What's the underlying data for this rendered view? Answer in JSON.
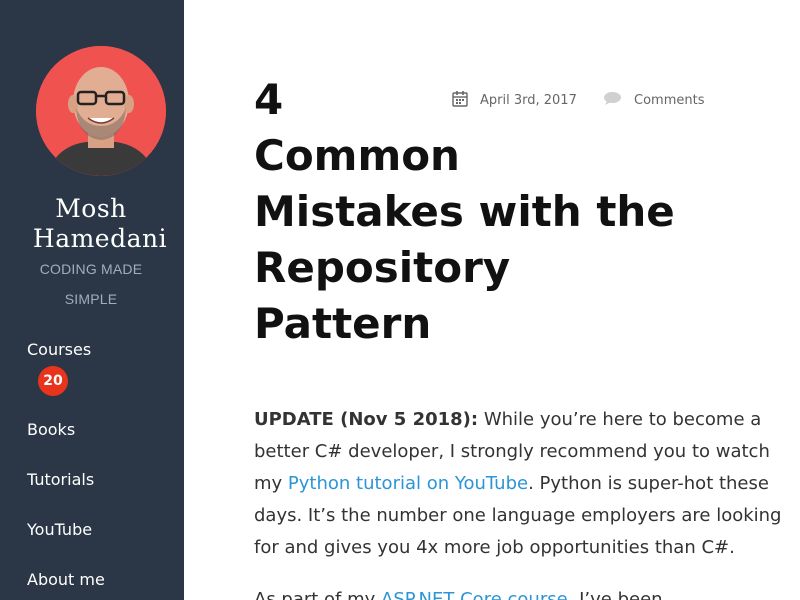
{
  "sidebar": {
    "author_first": "Mosh",
    "author_last": "Hamedani",
    "tagline_1": "CODING MADE",
    "tagline_2": "SIMPLE",
    "nav": {
      "courses": "Courses",
      "courses_badge": "20",
      "books": "Books",
      "tutorials": "Tutorials",
      "youtube": "YouTube",
      "about": "About me"
    }
  },
  "post": {
    "title_lines": [
      "4",
      "Common",
      "Mistakes with the",
      "Repository",
      "Pattern"
    ],
    "date": "April 3rd, 2017",
    "comments": "Comments",
    "update_label": "UPDATE (Nov 5 2018):",
    "p1_l1": " While you’re here to become a",
    "p1_l2": "better C# developer, I strongly recommend you to watch",
    "p1_l3a": "my ",
    "p1_link": "Python tutorial on YouTube",
    "p1_l3b": ". Python is super-hot these",
    "p1_l4": "days. It’s the number one language employers are looking",
    "p1_l5": "for and gives you 4x more job opportunities than C#.",
    "p2_l1a": "As part of my",
    "p2_link": "ASP.NET Core course",
    "p2_l1b": ", I’ve been"
  },
  "colors": {
    "sidebar_bg": "#2b3646",
    "badge_bg": "#e8341c",
    "link": "#2b95d6",
    "avatar_bg": "#f0524f"
  }
}
